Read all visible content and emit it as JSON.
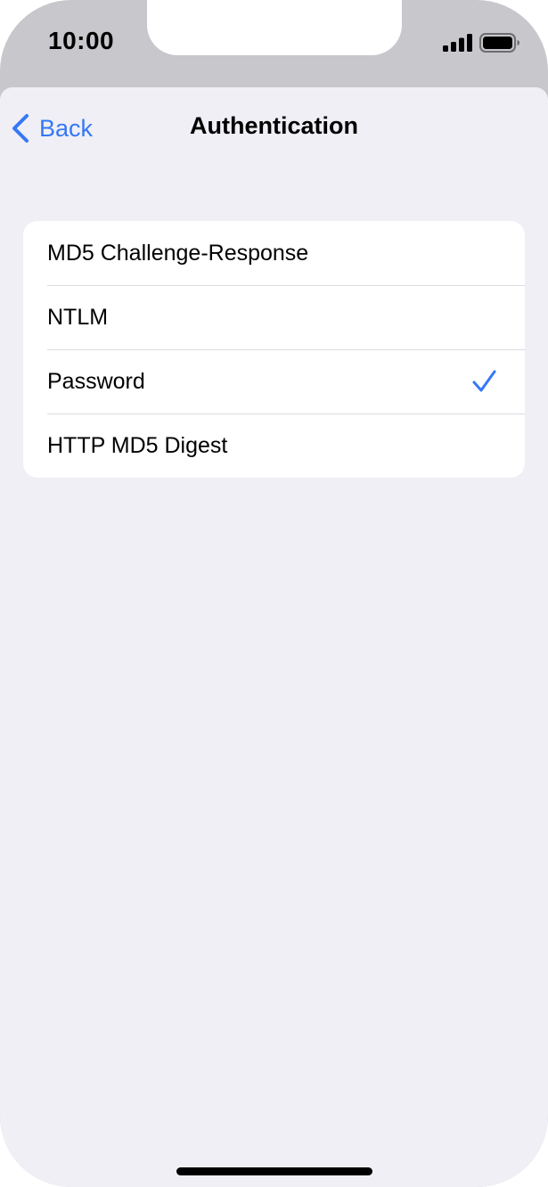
{
  "status_bar": {
    "time": "10:00",
    "signal_icon": "cellular-signal-icon",
    "battery_icon": "battery-icon"
  },
  "nav": {
    "back_label": "Back",
    "back_icon": "chevron-left-icon",
    "title": "Authentication"
  },
  "options": [
    {
      "label": "MD5 Challenge-Response",
      "selected": false
    },
    {
      "label": "NTLM",
      "selected": false
    },
    {
      "label": "Password",
      "selected": true
    },
    {
      "label": "HTTP MD5 Digest",
      "selected": false
    }
  ],
  "colors": {
    "accent": "#3478f6",
    "background": "#f0eff5",
    "bezel": "#c7c7cc"
  }
}
